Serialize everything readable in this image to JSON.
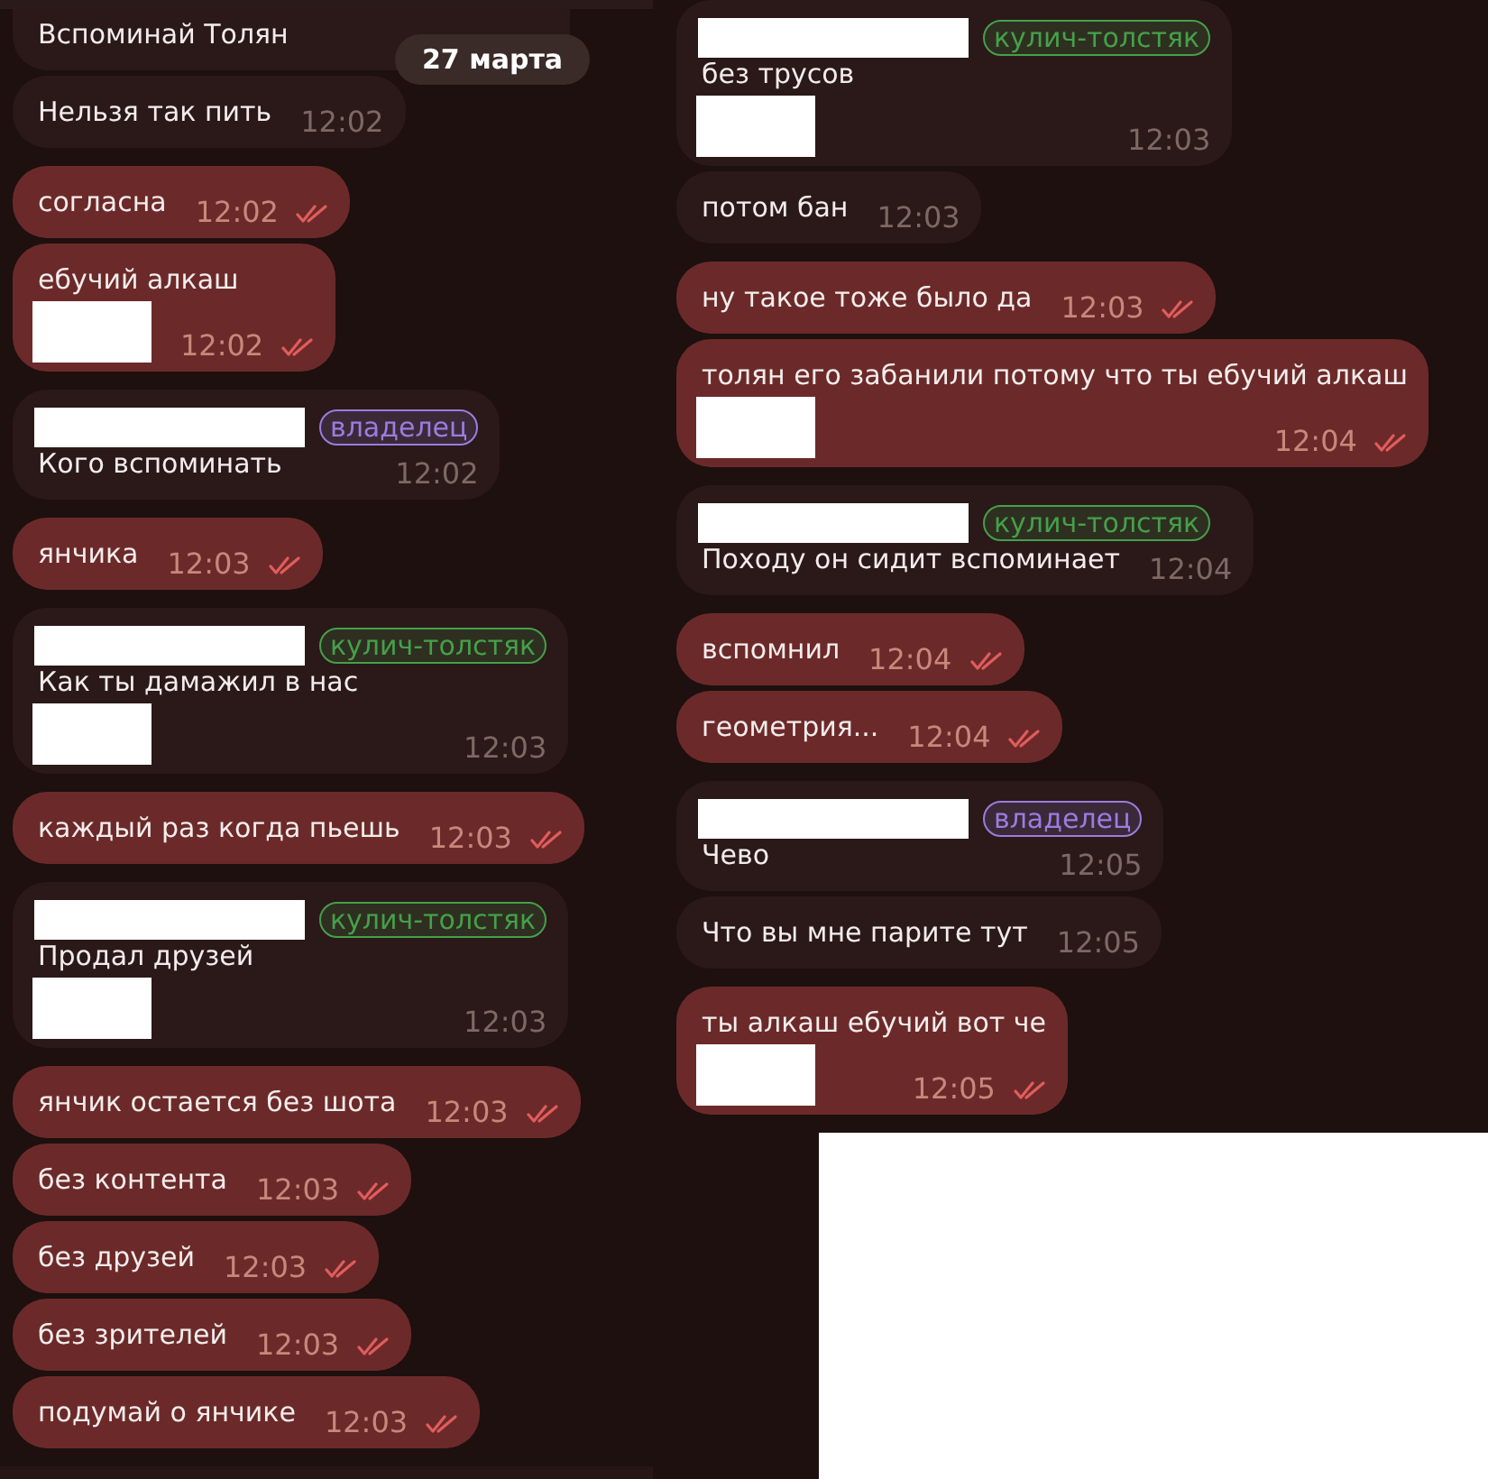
{
  "date_badge": "27 марта",
  "columns": [
    {
      "groups": [
        {
          "messages": [
            {
              "kind": "incoming",
              "text": "Вспоминай Толян"
            },
            {
              "kind": "incoming",
              "text": "Нельзя так пить",
              "time": "12:02"
            }
          ]
        },
        {
          "messages": [
            {
              "kind": "outgoing",
              "text": "согласна",
              "time": "12:02",
              "read": true
            },
            {
              "kind": "outgoing",
              "text": "ебучий алкаш",
              "media_redacted": true,
              "time": "12:02",
              "read": true
            }
          ]
        },
        {
          "messages": [
            {
              "kind": "incoming",
              "name_redacted": true,
              "tag": {
                "label": "владелец",
                "color": "#9a7de0"
              },
              "text": "Кого вспоминать",
              "time": "12:02"
            }
          ]
        },
        {
          "messages": [
            {
              "kind": "outgoing",
              "text": "янчика",
              "time": "12:03",
              "read": true
            }
          ]
        },
        {
          "messages": [
            {
              "kind": "incoming",
              "name_redacted": true,
              "tag": {
                "label": "кулич-толстяк",
                "color": "#45a04a"
              },
              "text": "Как ты дамажил в нас",
              "media_redacted": true,
              "time": "12:03"
            }
          ]
        },
        {
          "messages": [
            {
              "kind": "outgoing",
              "text": "каждый раз когда пьешь",
              "time": "12:03",
              "read": true
            }
          ]
        },
        {
          "messages": [
            {
              "kind": "incoming",
              "name_redacted": true,
              "tag": {
                "label": "кулич-толстяк",
                "color": "#45a04a"
              },
              "text": "Продал друзей",
              "media_redacted": true,
              "time": "12:03"
            }
          ]
        },
        {
          "messages": [
            {
              "kind": "outgoing",
              "text": "янчик остается без шота",
              "time": "12:03",
              "read": true
            },
            {
              "kind": "outgoing",
              "text": "без контента",
              "time": "12:03",
              "read": true
            },
            {
              "kind": "outgoing",
              "text": "без друзей",
              "time": "12:03",
              "read": true
            },
            {
              "kind": "outgoing",
              "text": "без зрителей",
              "time": "12:03",
              "read": true
            },
            {
              "kind": "outgoing",
              "text": "подумай о янчике",
              "time": "12:03",
              "read": true
            }
          ]
        }
      ]
    },
    {
      "groups": [
        {
          "messages": [
            {
              "kind": "incoming",
              "name_redacted": true,
              "tag": {
                "label": "кулич-толстяк",
                "color": "#45a04a"
              },
              "text": "без трусов",
              "media_redacted": true,
              "time": "12:03"
            },
            {
              "kind": "incoming",
              "text": "потом бан",
              "time": "12:03"
            }
          ]
        },
        {
          "messages": [
            {
              "kind": "outgoing",
              "text": "ну такое тоже было да",
              "time": "12:03",
              "read": true
            },
            {
              "kind": "outgoing",
              "text": "толян его забанили потому что ты ебучий алкаш",
              "media_redacted": true,
              "time": "12:04",
              "read": true
            }
          ]
        },
        {
          "messages": [
            {
              "kind": "incoming",
              "name_redacted": true,
              "tag": {
                "label": "кулич-толстяк",
                "color": "#45a04a"
              },
              "text": "Походу он сидит вспоминает",
              "time": "12:04"
            }
          ]
        },
        {
          "messages": [
            {
              "kind": "outgoing",
              "text": "вспомнил",
              "time": "12:04",
              "read": true
            },
            {
              "kind": "outgoing",
              "text": "геометрия...",
              "time": "12:04",
              "read": true
            }
          ]
        },
        {
          "messages": [
            {
              "kind": "incoming",
              "name_redacted": true,
              "tag": {
                "label": "владелец",
                "color": "#9a7de0"
              },
              "text": "Чево",
              "time": "12:05"
            },
            {
              "kind": "incoming",
              "text": "Что вы мне парите тут",
              "time": "12:05"
            }
          ]
        },
        {
          "messages": [
            {
              "kind": "outgoing",
              "text": "ты алкаш ебучий вот че",
              "media_redacted": true,
              "time": "12:05",
              "read": true
            }
          ]
        }
      ]
    }
  ]
}
